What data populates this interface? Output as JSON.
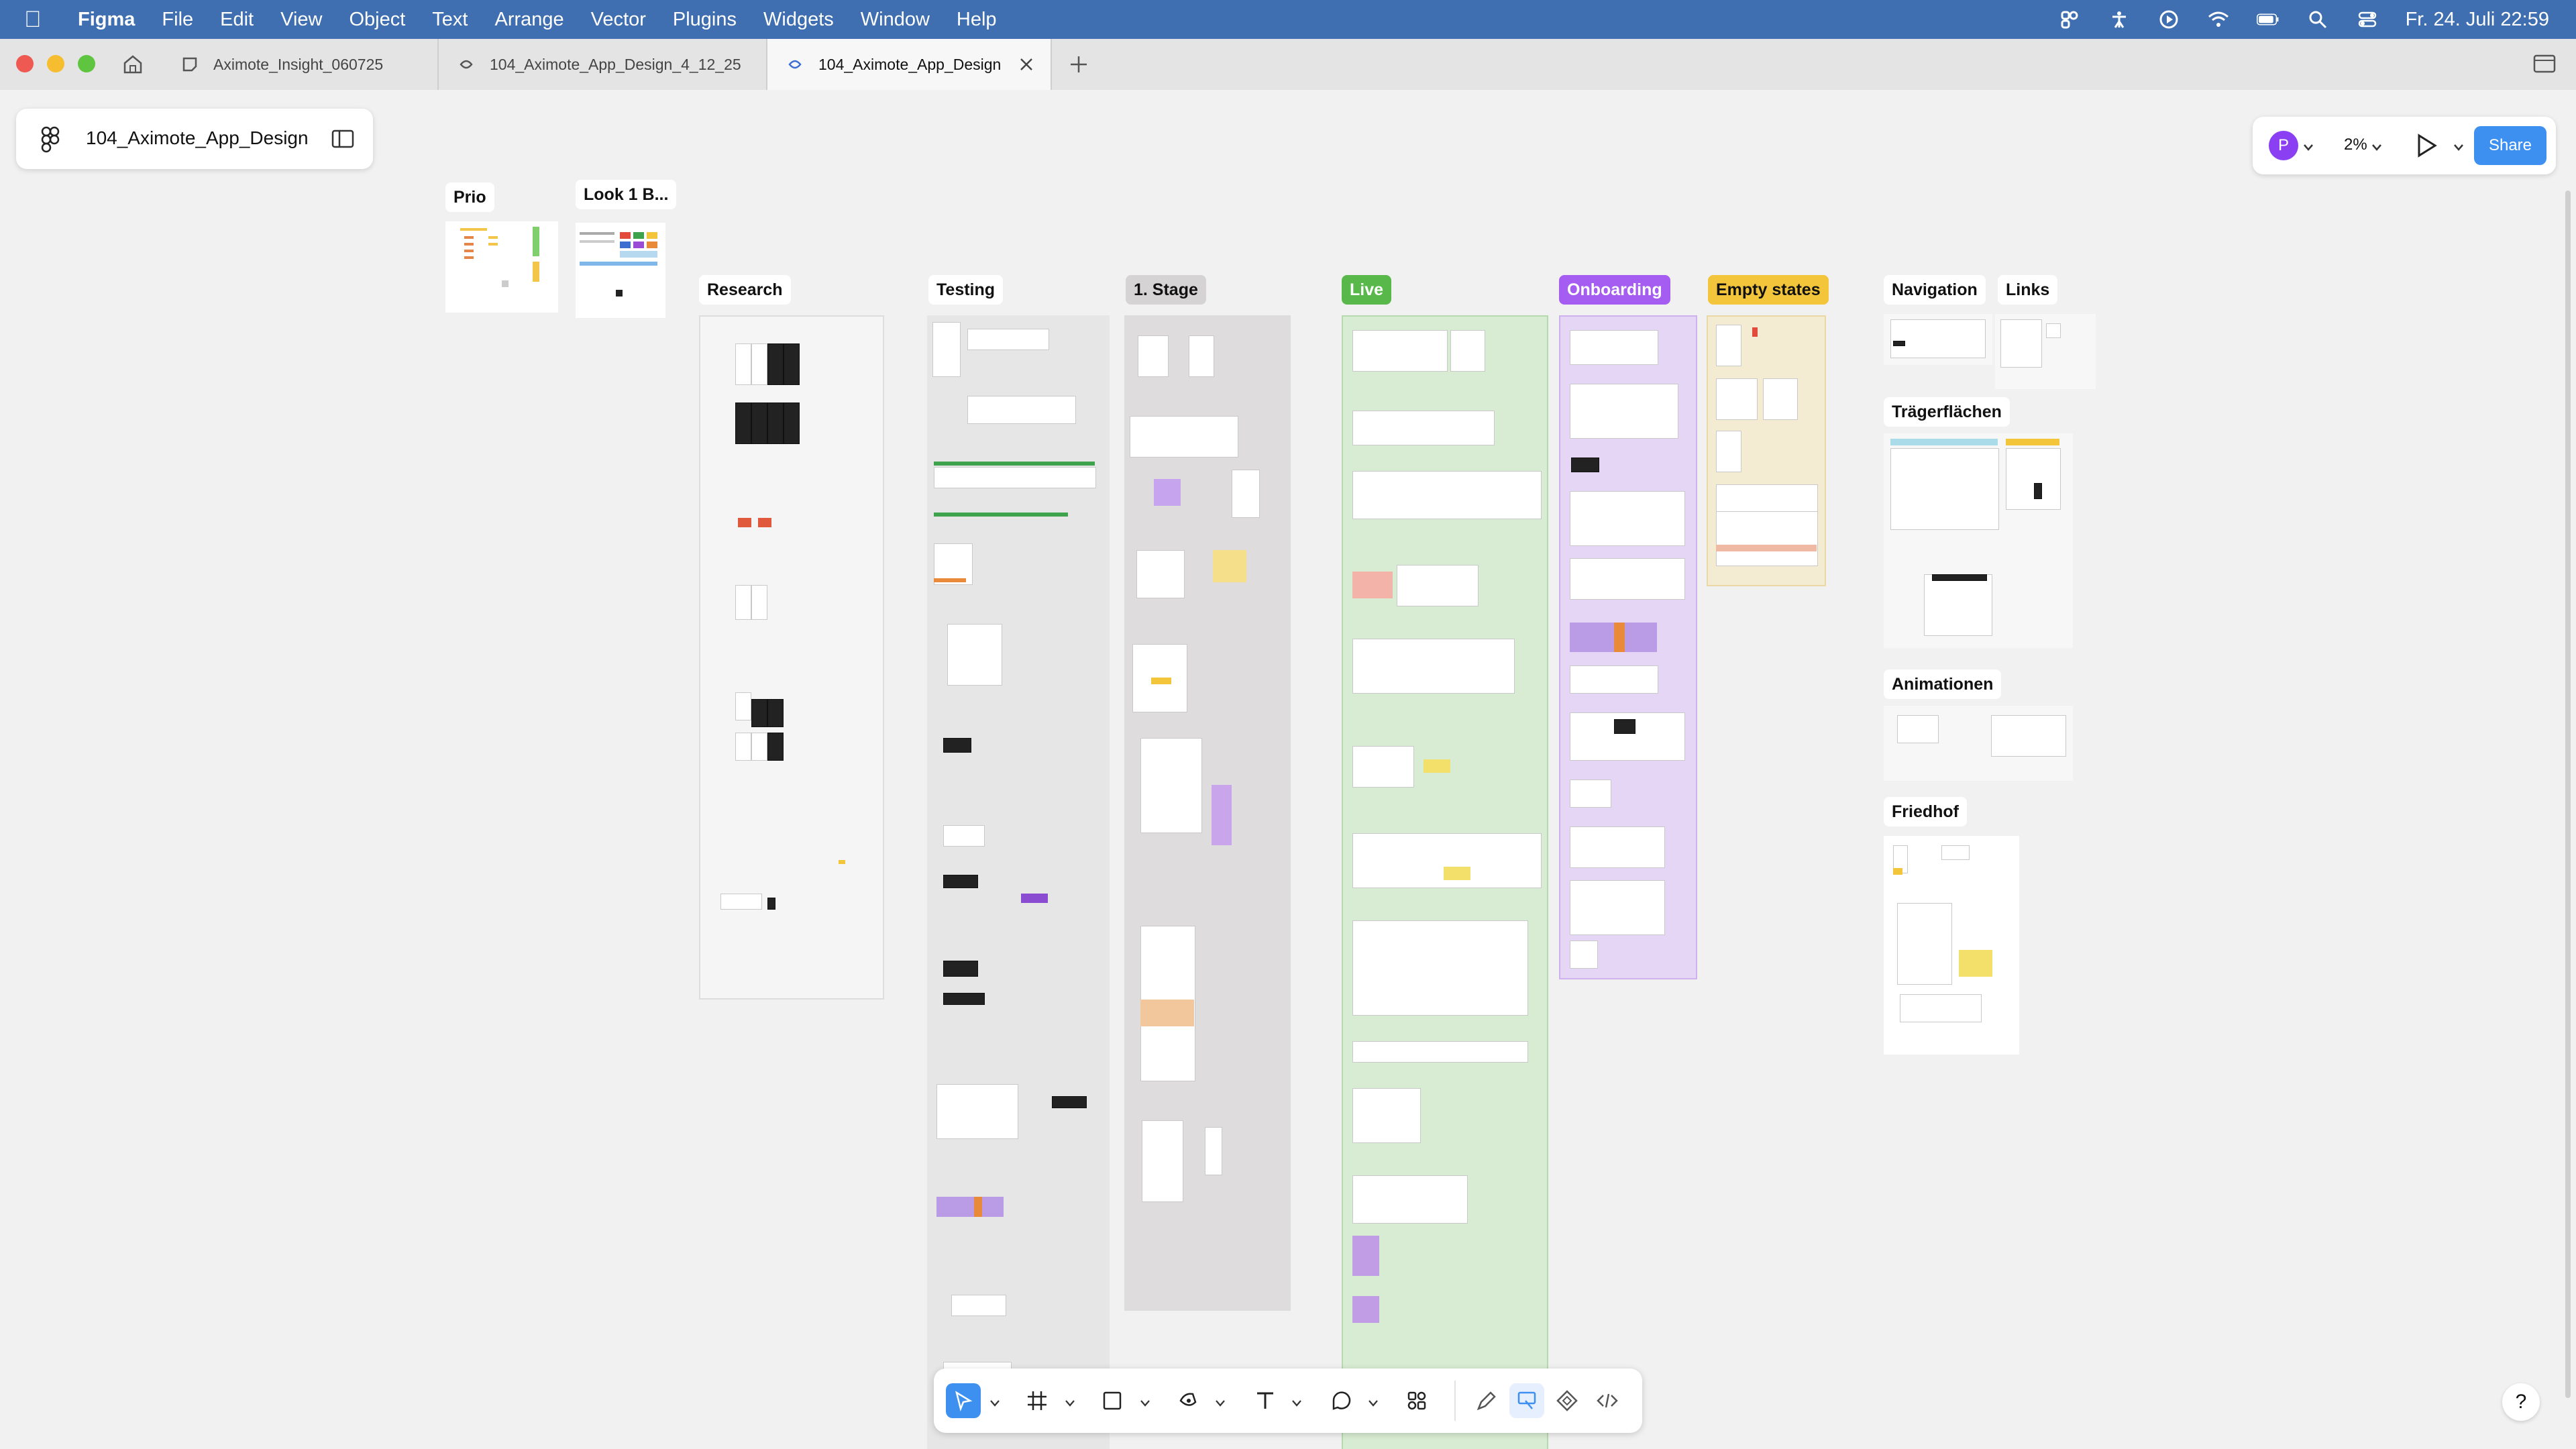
{
  "menubar": {
    "app_name": "Figma",
    "items": [
      "File",
      "Edit",
      "View",
      "Object",
      "Text",
      "Arrange",
      "Vector",
      "Plugins",
      "Widgets",
      "Window",
      "Help"
    ],
    "clock": "Fr. 24. Juli  22:59"
  },
  "tabs": [
    {
      "label": "Aximote_Insight_060725",
      "icon": "figjam-icon"
    },
    {
      "label": "104_Aximote_App_Design_4_12_25",
      "icon": "figma-file-icon"
    },
    {
      "label": "104_Aximote_App_Design",
      "icon": "figma-file-icon",
      "active": true
    }
  ],
  "file_panel": {
    "title": "104_Aximote_App_Design"
  },
  "right_panel": {
    "avatar": "P",
    "zoom": "2%",
    "share": "Share"
  },
  "sections": {
    "prio": "Prio",
    "look": "Look 1 B...",
    "research": "Research",
    "testing": "Testing",
    "stage1": "1. Stage",
    "live": "Live",
    "onboarding": "Onboarding",
    "empty": "Empty states",
    "navigation": "Navigation",
    "links": "Links",
    "traeger": "Trägerflächen",
    "animationen": "Animationen",
    "friedhof": "Friedhof"
  },
  "colors": {
    "menubar": "#3f6fb0",
    "live_label": "#58b94a",
    "live_bg": "#d8ecd3",
    "onboarding_label": "#a55cf0",
    "onboarding_bg": "#e6d6f6",
    "empty_label": "#f2c53a",
    "empty_bg": "#f3ecd2",
    "stage_bg": "#dedcdc",
    "testing_bg": "#e6e6e6",
    "accent": "#3d8ff0"
  },
  "toolbar": {
    "tools": [
      "move-icon",
      "frame-icon",
      "rectangle-icon",
      "pen-icon",
      "text-icon",
      "comment-icon",
      "actions-icon",
      "draw-icon",
      "design-mode-icon",
      "components-icon",
      "dev-mode-icon"
    ]
  },
  "help": "?"
}
